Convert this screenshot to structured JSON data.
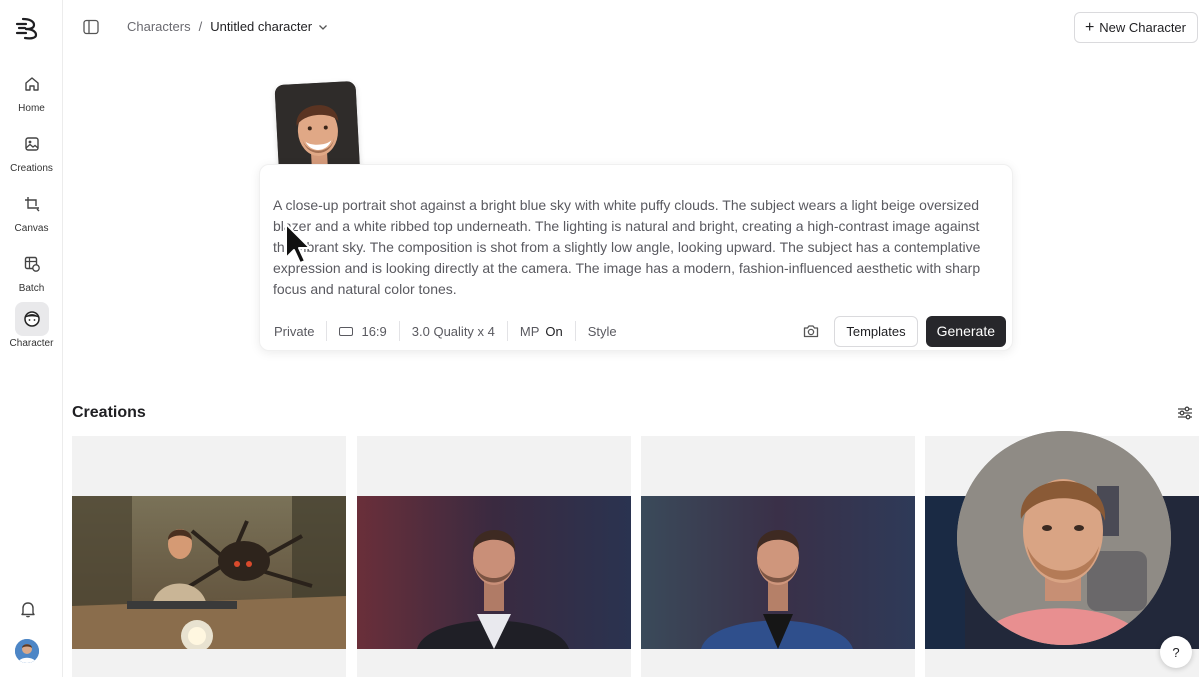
{
  "sidebar": {
    "items": [
      {
        "label": "Home",
        "icon": "home-icon"
      },
      {
        "label": "Creations",
        "icon": "image-icon"
      },
      {
        "label": "Canvas",
        "icon": "crop-canvas-icon"
      },
      {
        "label": "Batch",
        "icon": "batch-grid-icon"
      },
      {
        "label": "Character",
        "icon": "character-face-icon"
      }
    ],
    "active": "Character"
  },
  "header": {
    "breadcrumb_parent": "Characters",
    "breadcrumb_separator": "/",
    "breadcrumb_current": "Untitled character",
    "new_character_label": "New Character"
  },
  "prompt": {
    "text": "A close-up portrait shot against a bright blue sky with white puffy clouds. The subject wears a light beige oversized blazer and a white ribbed top underneath. The lighting is natural and bright, creating a high-contrast image against the vibrant sky. The composition is shot from a slightly low angle, looking upward. The subject has a contemplative expression and is looking directly at the camera. The image has a modern, fashion-influenced aesthetic with sharp focus and natural color tones."
  },
  "toolbar": {
    "privacy": "Private",
    "aspect_ratio": "16:9",
    "quality": "3.0 Quality x 4",
    "mp_label": "MP",
    "mp_value": "On",
    "style_label": "Style",
    "templates_label": "Templates",
    "generate_label": "Generate"
  },
  "creations": {
    "title": "Creations",
    "cards": [
      {
        "scene": "man-on-motorcycle-with-spider"
      },
      {
        "scene": "man-portrait-red-light"
      },
      {
        "scene": "man-portrait-blue-suit"
      },
      {
        "scene": "man-portrait-dark"
      }
    ]
  },
  "help_label": "?",
  "colors": {
    "accent_dark": "#27272b",
    "sidebar_active": "#e9e9eb",
    "text_muted": "#5a5a60"
  }
}
